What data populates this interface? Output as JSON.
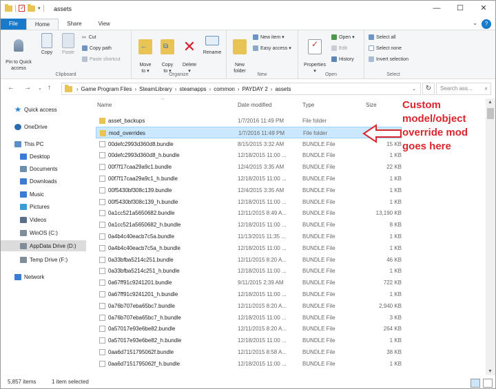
{
  "window": {
    "title": "assets",
    "minimize": "—",
    "maximize": "☐",
    "close": "✕"
  },
  "tabs": [
    {
      "label": "File"
    },
    {
      "label": "Home"
    },
    {
      "label": "Share"
    },
    {
      "label": "View"
    }
  ],
  "help": "?",
  "ribbon": {
    "clipboard": {
      "label": "Clipboard",
      "pin_to_quick_access": "Pin to Quick\naccess",
      "copy": "Copy",
      "paste": "Paste",
      "cut": "Cut",
      "copy_path": "Copy path",
      "paste_shortcut": "Paste shortcut"
    },
    "organize": {
      "label": "Organize",
      "move_to": "Move\nto ▾",
      "copy_to": "Copy\nto ▾",
      "delete": "Delete\n▾",
      "rename": "Rename"
    },
    "new": {
      "label": "New",
      "new_folder": "New\nfolder",
      "new_item": "New item ▾",
      "easy_access": "Easy access ▾"
    },
    "open": {
      "label": "Open",
      "properties": "Properties\n▾",
      "open": "Open ▾",
      "edit": "Edit",
      "history": "History"
    },
    "select": {
      "label": "Select",
      "select_all": "Select all",
      "select_none": "Select none",
      "invert_selection": "Invert selection"
    }
  },
  "address": {
    "crumbs": [
      "Game Program Files",
      "SteamLibrary",
      "steamapps",
      "common",
      "PAYDAY 2",
      "assets"
    ],
    "search_placeholder": "Search ass..."
  },
  "nav": [
    {
      "label": "Quick access",
      "color": "#2b88d8"
    },
    {
      "label": "OneDrive",
      "color": "#2b6cb0"
    },
    {
      "label": "This PC",
      "color": "#5a8fc9"
    },
    {
      "label": "Desktop",
      "color": "#3a7bd5"
    },
    {
      "label": "Documents",
      "color": "#6d8fb0"
    },
    {
      "label": "Downloads",
      "color": "#3a7bd5"
    },
    {
      "label": "Music",
      "color": "#3a7bd5"
    },
    {
      "label": "Pictures",
      "color": "#3a9bd5"
    },
    {
      "label": "Videos",
      "color": "#5a6f8a"
    },
    {
      "label": "WinOS (C:)",
      "color": "#7f8c99"
    },
    {
      "label": "AppData Drive (D:)",
      "color": "#7f8c99"
    },
    {
      "label": "Temp Drive (F:)",
      "color": "#7f8c99"
    },
    {
      "label": "Network",
      "color": "#3a7bd5"
    }
  ],
  "columns": {
    "name": "Name",
    "date": "Date modified",
    "type": "Type",
    "size": "Size"
  },
  "files": [
    {
      "name": "asset_backups",
      "date": "1/7/2016 11:49 PM",
      "type": "File folder",
      "size": "",
      "folder": true
    },
    {
      "name": "mod_overrides",
      "date": "1/7/2016 11:49 PM",
      "type": "File folder",
      "size": "",
      "folder": true
    },
    {
      "name": "00defc2993d360d8.bundle",
      "date": "8/15/2015 3:32 AM",
      "type": "BUNDLE File",
      "size": "15 KB"
    },
    {
      "name": "00defc2993d360d8_h.bundle",
      "date": "12/18/2015 11:00 ...",
      "type": "BUNDLE File",
      "size": "1 KB"
    },
    {
      "name": "00f7f17caa29a9c1.bundle",
      "date": "12/4/2015 3:35 AM",
      "type": "BUNDLE File",
      "size": "22 KB"
    },
    {
      "name": "00f7f17caa29a9c1_h.bundle",
      "date": "12/18/2015 11:00 ...",
      "type": "BUNDLE File",
      "size": "1 KB"
    },
    {
      "name": "00f5430bf308c139.bundle",
      "date": "12/4/2015 3:35 AM",
      "type": "BUNDLE File",
      "size": "1 KB"
    },
    {
      "name": "00f5430bf308c139_h.bundle",
      "date": "12/18/2015 11:00 ...",
      "type": "BUNDLE File",
      "size": "1 KB"
    },
    {
      "name": "0a1cc521a5650682.bundle",
      "date": "12/11/2015 8:49 A...",
      "type": "BUNDLE File",
      "size": "13,190 KB"
    },
    {
      "name": "0a1cc521a5650682_h.bundle",
      "date": "12/18/2015 11:00 ...",
      "type": "BUNDLE File",
      "size": "8 KB"
    },
    {
      "name": "0a4b4c40eacb7c5a.bundle",
      "date": "11/13/2015 11:35 ...",
      "type": "BUNDLE File",
      "size": "1 KB"
    },
    {
      "name": "0a4b4c40eacb7c5a_h.bundle",
      "date": "12/18/2015 11:00 ...",
      "type": "BUNDLE File",
      "size": "1 KB"
    },
    {
      "name": "0a33bfba5214c251.bundle",
      "date": "12/11/2015 8:20 A...",
      "type": "BUNDLE File",
      "size": "46 KB"
    },
    {
      "name": "0a33bfba5214c251_h.bundle",
      "date": "12/18/2015 11:00 ...",
      "type": "BUNDLE File",
      "size": "1 KB"
    },
    {
      "name": "0a67ff91c9241201.bundle",
      "date": "9/11/2015 2:39 AM",
      "type": "BUNDLE File",
      "size": "722 KB"
    },
    {
      "name": "0a67ff91c9241201_h.bundle",
      "date": "12/18/2015 11:00 ...",
      "type": "BUNDLE File",
      "size": "1 KB"
    },
    {
      "name": "0a76b707eba65bc7.bundle",
      "date": "12/11/2015 8:20 A...",
      "type": "BUNDLE File",
      "size": "2,940 KB"
    },
    {
      "name": "0a76b707eba65bc7_h.bundle",
      "date": "12/18/2015 11:00 ...",
      "type": "BUNDLE File",
      "size": "3 KB"
    },
    {
      "name": "0a57017e93e6be82.bundle",
      "date": "12/11/2015 8:20 A...",
      "type": "BUNDLE File",
      "size": "264 KB"
    },
    {
      "name": "0a57017e93e6be82_h.bundle",
      "date": "12/18/2015 11:00 ...",
      "type": "BUNDLE File",
      "size": "1 KB"
    },
    {
      "name": "0aa6d7151795062f.bundle",
      "date": "12/11/2015 8:58 A...",
      "type": "BUNDLE File",
      "size": "38 KB"
    },
    {
      "name": "0aa6d7151795062f_h.bundle",
      "date": "12/18/2015 11:00 ...",
      "type": "BUNDLE File",
      "size": "1 KB"
    }
  ],
  "status": {
    "count": "5,857 items",
    "selected": "1 item selected"
  },
  "callout": {
    "line1": "Custom",
    "line2": "model/object",
    "line3": "override mod",
    "line4": "goes here",
    "color": "#d9262c"
  }
}
